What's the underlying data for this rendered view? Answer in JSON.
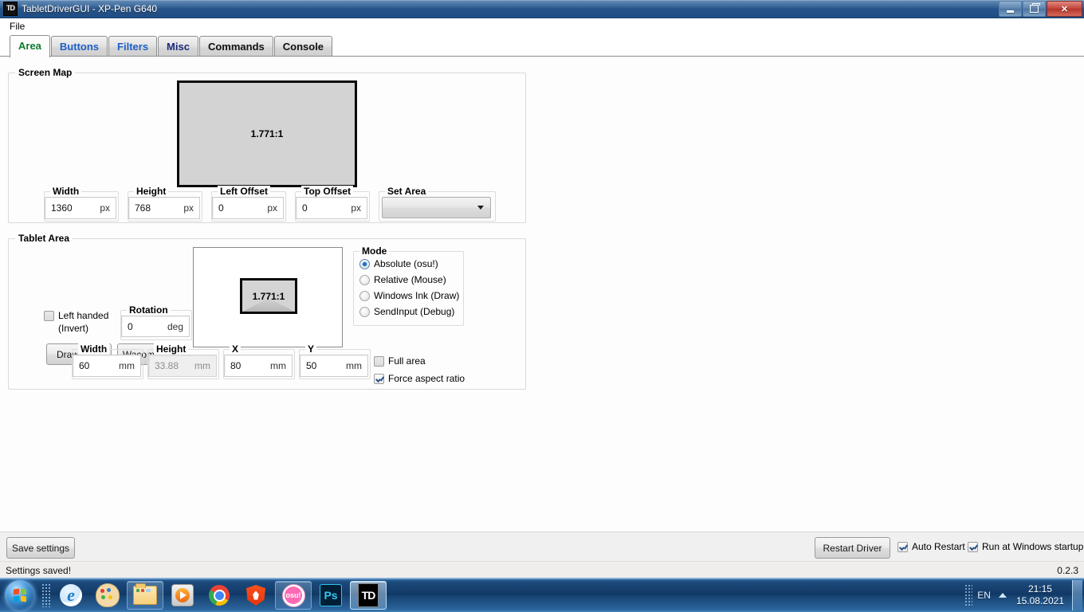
{
  "window": {
    "title": "TabletDriverGUI - XP-Pen G640",
    "icon": "TD",
    "buttons": {
      "minimize": "minimize-icon",
      "restore": "restore-icon",
      "close": "✕"
    }
  },
  "menubar": {
    "items": [
      "File"
    ]
  },
  "tabs": [
    {
      "label": "Area",
      "color": "#0d7c2e",
      "active": true
    },
    {
      "label": "Buttons",
      "color": "#1f5fc4",
      "active": false
    },
    {
      "label": "Filters",
      "color": "#1f5fc4",
      "active": false
    },
    {
      "label": "Misc",
      "color": "#1b2a7a",
      "active": false
    },
    {
      "label": "Commands",
      "color": "#111111",
      "active": false
    },
    {
      "label": "Console",
      "color": "#111111",
      "active": false
    }
  ],
  "screen_map": {
    "title": "Screen Map",
    "preview_ratio": "1.771:1",
    "fields": [
      {
        "label": "Width",
        "value": "1360",
        "unit": "px",
        "disabled": false
      },
      {
        "label": "Height",
        "value": "768",
        "unit": "px",
        "disabled": false
      },
      {
        "label": "Left Offset",
        "value": "0",
        "unit": "px",
        "disabled": false
      },
      {
        "label": "Top Offset",
        "value": "0",
        "unit": "px",
        "disabled": false
      }
    ],
    "set_area": {
      "label": "Set Area",
      "value": "",
      "caret": "chevron-down-icon"
    }
  },
  "tablet_area": {
    "title": "Tablet Area",
    "left_handed": {
      "label_line1": "Left handed",
      "label_line2": "(Invert)",
      "checked": false
    },
    "rotation": {
      "label": "Rotation",
      "value": "0",
      "unit": "deg"
    },
    "buttons": [
      {
        "label": "Draw Area"
      },
      {
        "label": "Wacom Area"
      }
    ],
    "preview_ratio": "1.771:1",
    "mode": {
      "title": "Mode",
      "options": [
        {
          "label": "Absolute (osu!)",
          "checked": true
        },
        {
          "label": "Relative (Mouse)",
          "checked": false
        },
        {
          "label": "Windows Ink (Draw)",
          "checked": false
        },
        {
          "label": "SendInput (Debug)",
          "checked": false
        }
      ]
    },
    "fields": [
      {
        "label": "Width",
        "value": "60",
        "unit": "mm",
        "disabled": false
      },
      {
        "label": "Height",
        "value": "33.88",
        "unit": "mm",
        "disabled": true
      },
      {
        "label": "X",
        "value": "80",
        "unit": "mm",
        "disabled": false
      },
      {
        "label": "Y",
        "value": "50",
        "unit": "mm",
        "disabled": false
      }
    ],
    "checkboxes": [
      {
        "label": "Full area",
        "checked": false
      },
      {
        "label": "Force aspect ratio",
        "checked": true
      }
    ]
  },
  "bottom_bar": {
    "save_settings": "Save settings",
    "restart_driver": "Restart Driver",
    "auto_restart": {
      "label": "Auto Restart",
      "checked": true
    },
    "run_at_startup": {
      "label": "Run at Windows startup",
      "checked": true
    }
  },
  "status_bar": {
    "message": "Settings saved!",
    "version": "0.2.3"
  },
  "taskbar": {
    "start": "windows-start-orb",
    "items": [
      {
        "name": "internet-explorer",
        "label": "e",
        "state": "quicklaunch"
      },
      {
        "name": "paint",
        "label": "",
        "state": "quicklaunch"
      },
      {
        "name": "windows-explorer",
        "label": "",
        "state": "pinned"
      },
      {
        "name": "windows-media-player",
        "label": "",
        "state": "quicklaunch"
      },
      {
        "name": "google-chrome",
        "label": "",
        "state": "quicklaunch"
      },
      {
        "name": "brave-browser",
        "label": "",
        "state": "quicklaunch"
      },
      {
        "name": "osu",
        "label": "osu!",
        "state": "pinned"
      },
      {
        "name": "photoshop",
        "label": "Ps",
        "state": "quicklaunch"
      },
      {
        "name": "tabletdrivergui",
        "label": "TD",
        "state": "active"
      }
    ],
    "tray": {
      "language": "EN",
      "show_hidden": "chevron-up-icon",
      "time": "21:15",
      "date": "15.08.2021"
    }
  }
}
